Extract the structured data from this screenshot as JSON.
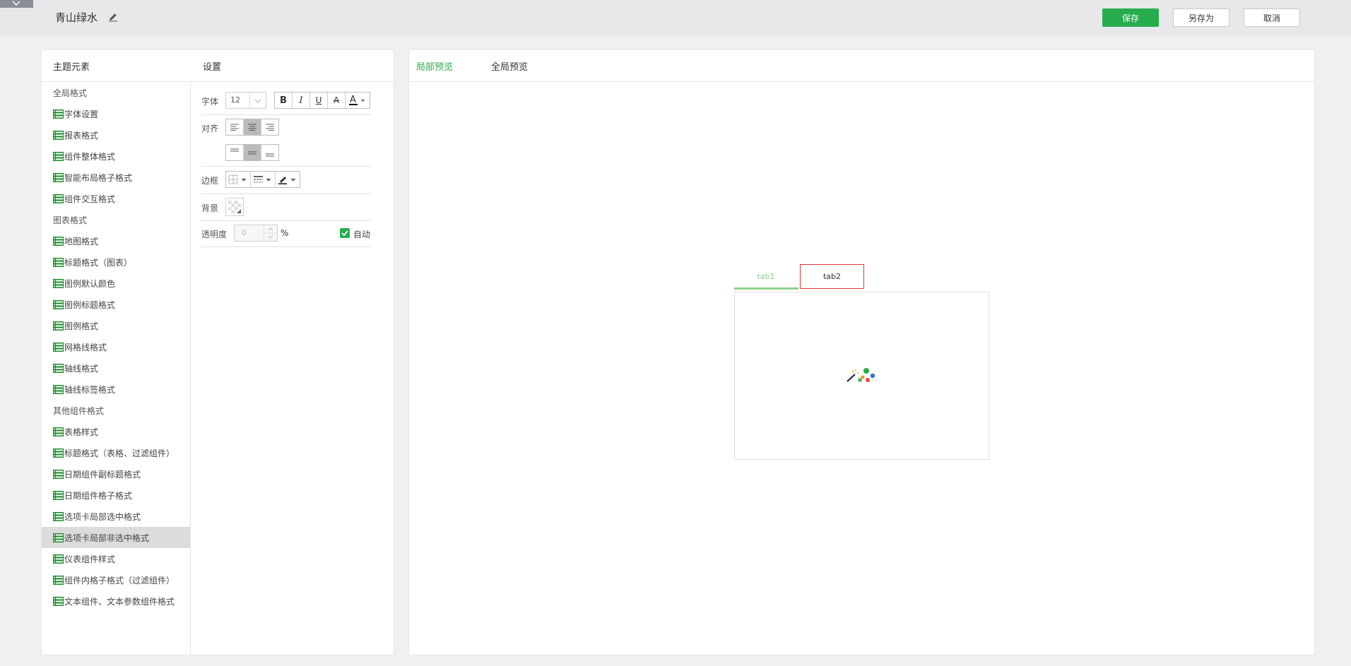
{
  "header": {
    "title": "青山绿水",
    "save_label": "保存",
    "saveas_label": "另存为",
    "cancel_label": "取消"
  },
  "colors": {
    "accent": "#27ad4e",
    "selected_row": "#dcdcdc",
    "tab1_text": "#8ed08e",
    "tab2_border": "#e23232"
  },
  "left_panel": {
    "col1_title": "主题元素",
    "col2_title": "设置",
    "tree": [
      {
        "label": "全局格式",
        "type": "group"
      },
      {
        "label": "字体设置",
        "type": "leaf"
      },
      {
        "label": "报表格式",
        "type": "leaf"
      },
      {
        "label": "组件整体格式",
        "type": "leaf"
      },
      {
        "label": "智能布局格子格式",
        "type": "leaf"
      },
      {
        "label": "组件交互格式",
        "type": "leaf"
      },
      {
        "label": "图表格式",
        "type": "group"
      },
      {
        "label": "地图格式",
        "type": "leaf"
      },
      {
        "label": "标题格式（图表）",
        "type": "leaf"
      },
      {
        "label": "图例默认颜色",
        "type": "leaf"
      },
      {
        "label": "图例标题格式",
        "type": "leaf"
      },
      {
        "label": "图例格式",
        "type": "leaf"
      },
      {
        "label": "网格线格式",
        "type": "leaf"
      },
      {
        "label": "轴线格式",
        "type": "leaf"
      },
      {
        "label": "轴线标签格式",
        "type": "leaf"
      },
      {
        "label": "其他组件格式",
        "type": "group"
      },
      {
        "label": "表格样式",
        "type": "leaf"
      },
      {
        "label": "标题格式（表格、过滤组件）",
        "type": "leaf"
      },
      {
        "label": "日期组件副标题格式",
        "type": "leaf"
      },
      {
        "label": "日期组件格子格式",
        "type": "leaf"
      },
      {
        "label": "选项卡局部选中格式",
        "type": "leaf"
      },
      {
        "label": "选项卡局部非选中格式",
        "type": "leaf",
        "selected": true
      },
      {
        "label": "仪表组件样式",
        "type": "leaf"
      },
      {
        "label": "组件内格子格式（过滤组件）",
        "type": "leaf"
      },
      {
        "label": "文本组件、文本参数组件格式",
        "type": "leaf"
      }
    ],
    "settings": {
      "font_label": "字体",
      "font_size": "12",
      "align_label": "对齐",
      "border_label": "边框",
      "background_label": "背景",
      "opacity_label": "透明度",
      "opacity_value": "0",
      "percent": "%",
      "auto_label": "自动"
    }
  },
  "right_panel": {
    "tab_local": "局部预览",
    "tab_global": "全局预览",
    "preview": {
      "tab1": "tab1",
      "tab2": "tab2"
    }
  }
}
